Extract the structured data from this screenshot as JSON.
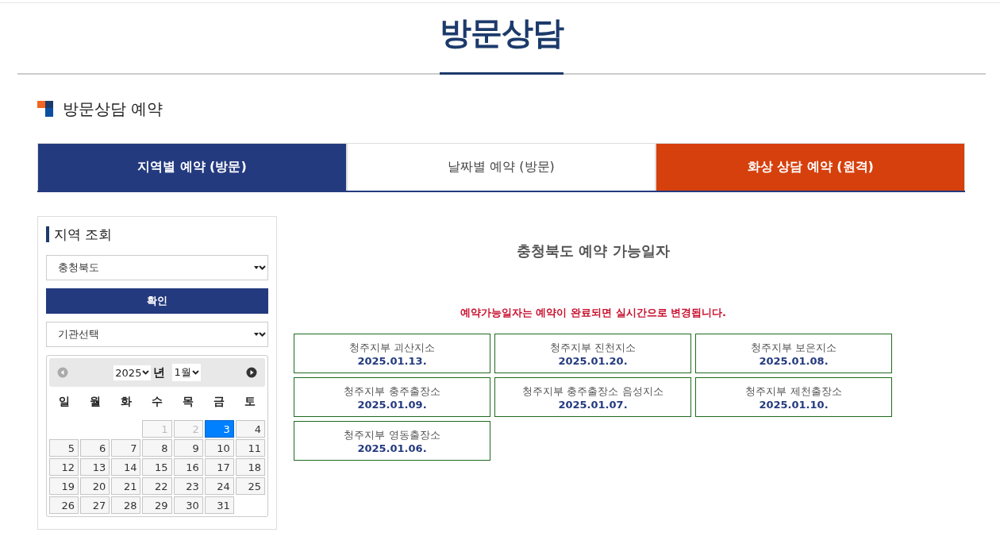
{
  "page_title": "방문상담",
  "section_title": "방문상담 예약",
  "tabs": [
    {
      "label": "지역별 예약 (방문)",
      "selected": true,
      "kind": "visit"
    },
    {
      "label": "날짜별 예약 (방문)",
      "selected": false,
      "kind": "visit"
    },
    {
      "label": "화상 상담 예약 (원격)",
      "selected": false,
      "kind": "remote"
    }
  ],
  "sidebar": {
    "title": "지역 조회",
    "region_select": {
      "value": "충청북도"
    },
    "confirm_button": "확인",
    "agency_select": {
      "value": "기관선택"
    },
    "calendar": {
      "year": "2025",
      "year_suffix": "년",
      "month": "1월",
      "weekdays": [
        "일",
        "월",
        "화",
        "수",
        "목",
        "금",
        "토"
      ],
      "weeks": [
        {
          "days": [
            {
              "kind": "blank"
            },
            {
              "kind": "blank"
            },
            {
              "kind": "blank"
            },
            {
              "kind": "day",
              "label": "1",
              "disabled": true,
              "selected": false
            },
            {
              "label": "2",
              "disabled": true,
              "selected": false
            },
            {
              "label": "3",
              "disabled": false,
              "selected": true
            },
            {
              "label": "4",
              "disabled": false,
              "selected": false
            }
          ]
        },
        {
          "days": [
            {
              "label": "5",
              "disabled": false,
              "selected": false
            },
            {
              "label": "6",
              "disabled": false,
              "selected": false
            },
            {
              "label": "7",
              "disabled": false,
              "selected": false
            },
            {
              "label": "8",
              "disabled": false,
              "selected": false
            },
            {
              "label": "9",
              "disabled": false,
              "selected": false
            },
            {
              "label": "10",
              "disabled": false,
              "selected": false
            },
            {
              "label": "11",
              "disabled": false,
              "selected": false
            }
          ]
        },
        {
          "days": [
            {
              "label": "12",
              "disabled": false,
              "selected": false
            },
            {
              "label": "13",
              "disabled": false,
              "selected": false
            },
            {
              "label": "14",
              "disabled": false,
              "selected": false
            },
            {
              "label": "15",
              "disabled": false,
              "selected": false
            },
            {
              "label": "16",
              "disabled": false,
              "selected": false
            },
            {
              "label": "17",
              "disabled": false,
              "selected": false
            },
            {
              "label": "18",
              "disabled": false,
              "selected": false
            }
          ]
        },
        {
          "days": [
            {
              "label": "19",
              "disabled": false,
              "selected": false
            },
            {
              "label": "20",
              "disabled": false,
              "selected": false
            },
            {
              "label": "21",
              "disabled": false,
              "selected": false
            },
            {
              "label": "22",
              "disabled": false,
              "selected": false
            },
            {
              "label": "23",
              "disabled": false,
              "selected": false
            },
            {
              "label": "24",
              "disabled": false,
              "selected": false
            },
            {
              "label": "25",
              "disabled": false,
              "selected": false
            }
          ]
        },
        {
          "days": [
            {
              "label": "26",
              "disabled": false,
              "selected": false
            },
            {
              "label": "27",
              "disabled": false,
              "selected": false
            },
            {
              "label": "28",
              "disabled": false,
              "selected": false
            },
            {
              "label": "29",
              "disabled": false,
              "selected": false
            },
            {
              "label": "30",
              "disabled": false,
              "selected": false
            },
            {
              "label": "31",
              "disabled": false,
              "selected": false
            }
          ]
        }
      ]
    }
  },
  "results": {
    "title": "충청북도 예약 가능일자",
    "notice": "예약가능일자는 예약이 완료되면 실시간으로 변경됩니다.",
    "offices": [
      {
        "name": "청주지부 괴산지소",
        "date": "2025.01.13."
      },
      {
        "name": "청주지부 진천지소",
        "date": "2025.01.20."
      },
      {
        "name": "청주지부 보은지소",
        "date": "2025.01.08."
      },
      {
        "name": "청주지부 충주출장소",
        "date": "2025.01.09."
      },
      {
        "name": "청주지부 충주출장소 음성지소",
        "date": "2025.01.07."
      },
      {
        "name": "청주지부 제천출장소",
        "date": "2025.01.10."
      },
      {
        "name": "청주지부 영동출장소",
        "date": "2025.01.06."
      }
    ]
  }
}
